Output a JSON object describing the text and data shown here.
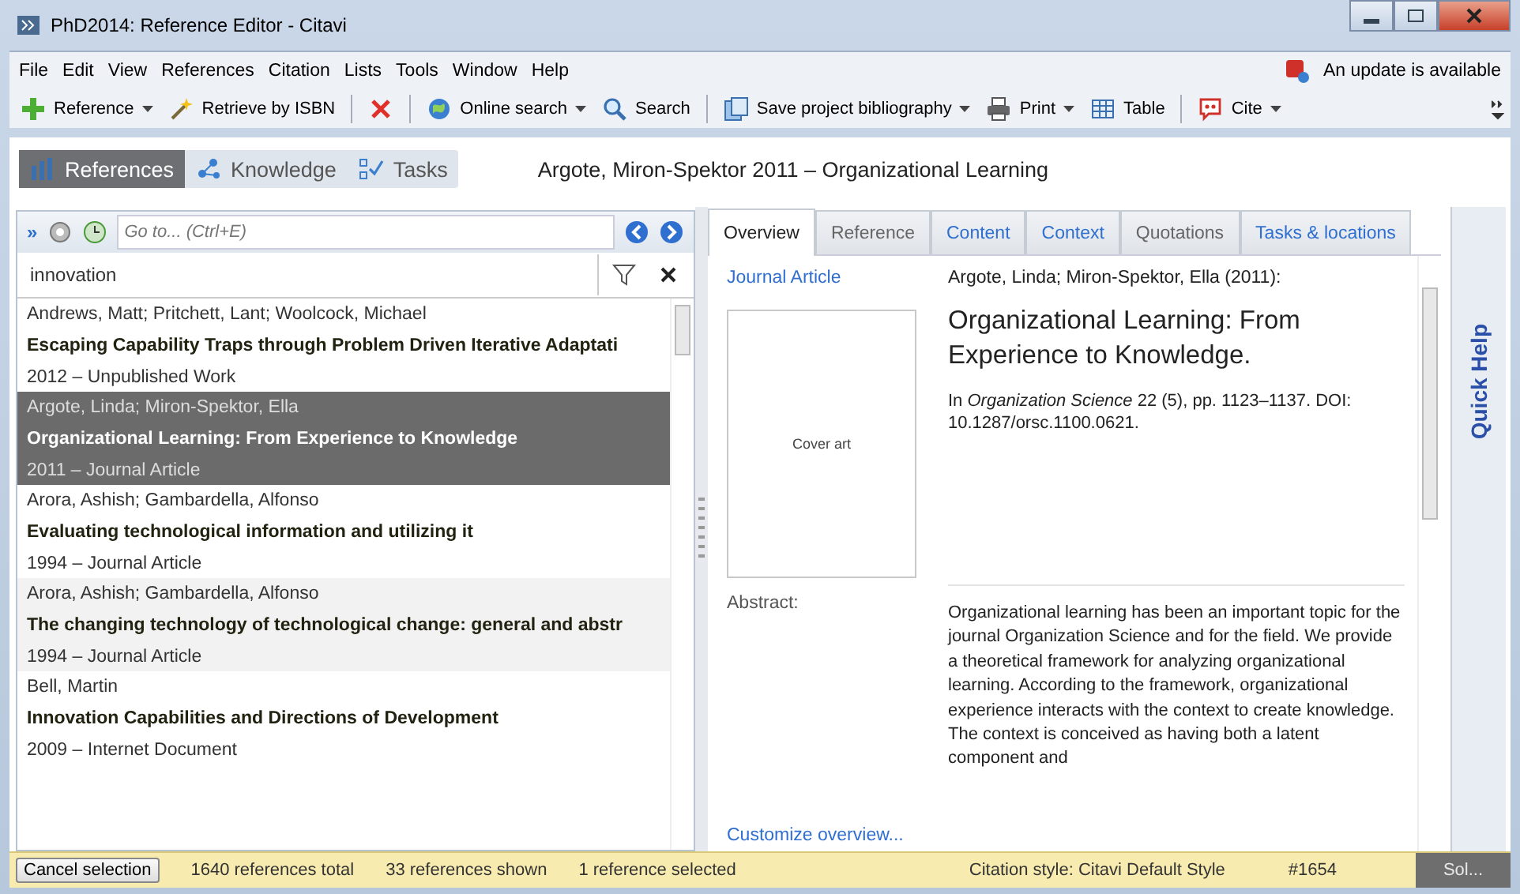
{
  "window": {
    "title": "PhD2014: Reference Editor - Citavi"
  },
  "menu": [
    "File",
    "Edit",
    "View",
    "References",
    "Citation",
    "Lists",
    "Tools",
    "Window",
    "Help"
  ],
  "update_notice": "An update is available",
  "toolbar": [
    {
      "kind": "dropdown",
      "label": "Reference"
    },
    {
      "kind": "button",
      "label": "Retrieve by ISBN"
    },
    {
      "kind": "separator"
    },
    {
      "kind": "icon_button"
    },
    {
      "kind": "separator"
    },
    {
      "kind": "dropdown",
      "label": "Online search"
    },
    {
      "kind": "button",
      "label": "Search"
    },
    {
      "kind": "separator"
    },
    {
      "kind": "dropdown",
      "label": "Save project bibliography"
    },
    {
      "kind": "dropdown",
      "label": "Print"
    },
    {
      "kind": "button",
      "label": "Table"
    },
    {
      "kind": "separator"
    },
    {
      "kind": "dropdown",
      "label": "Cite"
    }
  ],
  "nav_tabs": [
    {
      "label": "References",
      "selected": true
    },
    {
      "label": "Knowledge",
      "selected": false
    },
    {
      "label": "Tasks",
      "selected": false
    }
  ],
  "reference_heading": "Argote, Miron-Spektor 2011 – Organizational Learning",
  "goto": {
    "expand": "»",
    "placeholder": "Go to... (Ctrl+E)"
  },
  "search": {
    "value": "innovation"
  },
  "references": [
    {
      "authors": "Andrews, Matt; Pritchett, Lant; Woolcock, Michael",
      "title": "Escaping Capability Traps through Problem Driven Iterative Adaptati",
      "year_type": "2012 – Unpublished Work",
      "selected": false,
      "hover": false
    },
    {
      "authors": "Argote, Linda; Miron-Spektor, Ella",
      "title": "Organizational Learning: From Experience to Knowledge",
      "year_type": "2011 – Journal Article",
      "selected": true,
      "hover": false
    },
    {
      "authors": "Arora, Ashish; Gambardella, Alfonso",
      "title": "Evaluating technological information and utilizing it",
      "year_type": "1994 – Journal Article",
      "selected": false,
      "hover": false
    },
    {
      "authors": "Arora, Ashish; Gambardella, Alfonso",
      "title": "The changing technology of technological change: general and abstr",
      "year_type": "1994 – Journal Article",
      "selected": false,
      "hover": true
    },
    {
      "authors": "Bell, Martin",
      "title": "Innovation Capabilities and Directions of Development",
      "year_type": "2009 – Internet Document",
      "selected": false,
      "hover": false
    }
  ],
  "detail_tabs": [
    {
      "label": "Overview",
      "selected": true,
      "has_content": true
    },
    {
      "label": "Reference",
      "selected": false,
      "has_content": false
    },
    {
      "label": "Content",
      "selected": false,
      "has_content": true
    },
    {
      "label": "Context",
      "selected": false,
      "has_content": true
    },
    {
      "label": "Quotations",
      "selected": false,
      "has_content": false
    },
    {
      "label": "Tasks & locations",
      "selected": false,
      "has_content": true
    }
  ],
  "overview": {
    "reference_type": "Journal Article",
    "cover": "Cover art",
    "citation": "Argote, Linda; Miron-Spektor, Ella (2011):",
    "title": "Organizational Learning: From Experience to Knowledge.",
    "source": "In *Organization Science* 22 (5), pp. 1123–1137. DOI: 10.1287/orsc.1100.0621.",
    "abstract_label": "Abstract:",
    "abstract": "Organizational learning has been an important topic for the journal Organization Science and for the field. We provide a theoretical framework for analyzing organizational learning. According to the framework, organizational experience interacts with the context to create knowledge. The context is conceived as having both a latent component and",
    "customize_link": "Customize overview..."
  },
  "quick_help": "Quick Help",
  "status_bar": {
    "cancel_button": "Cancel selection",
    "total": "1640 references total",
    "shown": "33 references shown",
    "selected": "1 reference selected",
    "citation_style": "Citation style: Citavi Default Style",
    "id": "#1654",
    "solution_button": "Sol..."
  }
}
